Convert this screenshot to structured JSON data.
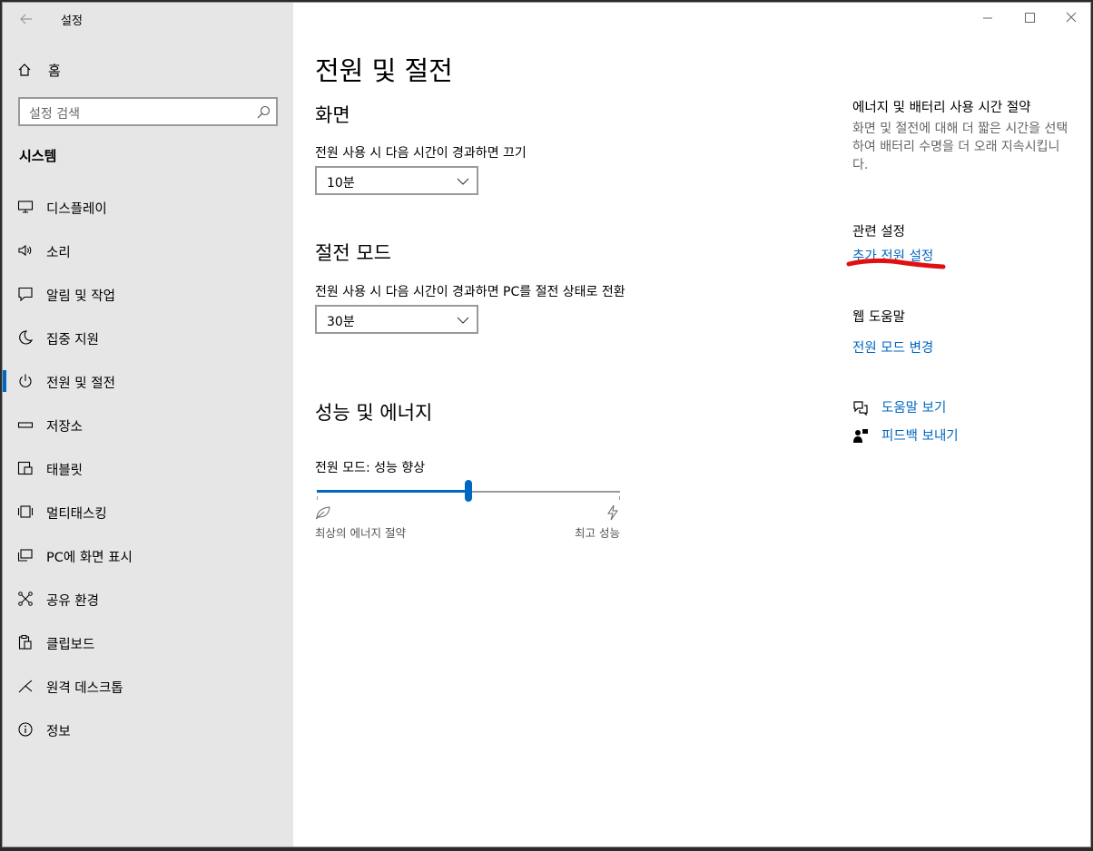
{
  "window": {
    "app_title": "설정"
  },
  "sidebar": {
    "home_label": "홈",
    "search_placeholder": "설정 검색",
    "section_title": "시스템",
    "items": [
      {
        "label": "디스플레이",
        "icon": "monitor-icon"
      },
      {
        "label": "소리",
        "icon": "speaker-icon"
      },
      {
        "label": "알림 및 작업",
        "icon": "notification-icon"
      },
      {
        "label": "집중 지원",
        "icon": "moon-icon"
      },
      {
        "label": "전원 및 절전",
        "icon": "power-icon",
        "active": true
      },
      {
        "label": "저장소",
        "icon": "storage-icon"
      },
      {
        "label": "태블릿",
        "icon": "tablet-icon"
      },
      {
        "label": "멀티태스킹",
        "icon": "multitasking-icon"
      },
      {
        "label": "PC에 화면 표시",
        "icon": "project-icon"
      },
      {
        "label": "공유 환경",
        "icon": "share-icon"
      },
      {
        "label": "클립보드",
        "icon": "clipboard-icon"
      },
      {
        "label": "원격 데스크톱",
        "icon": "remote-icon"
      },
      {
        "label": "정보",
        "icon": "info-icon"
      }
    ]
  },
  "main": {
    "title": "전원 및 절전",
    "screen": {
      "heading": "화면",
      "label": "전원 사용 시 다음 시간이 경과하면 끄기",
      "value": "10분"
    },
    "sleep": {
      "heading": "절전 모드",
      "label": "전원 사용 시 다음 시간이 경과하면 PC를 절전 상태로 전환",
      "value": "30분"
    },
    "performance": {
      "heading": "성능 및 에너지",
      "mode_label": "전원 모드: 성능 향상",
      "slider_fraction": 0.5,
      "min_label": "최상의 에너지 절약",
      "max_label": "최고 성능"
    }
  },
  "right": {
    "save": {
      "heading": "에너지 및 배터리 사용 시간 절약",
      "desc": "화면 및 절전에 대해 더 짧은 시간을 선택하여 배터리 수명을 더 오래 지속시킵니다."
    },
    "related": {
      "heading": "관련 설정",
      "link": "추가 전원 설정"
    },
    "web_help": {
      "heading": "웹 도움말",
      "link": "전원 모드 변경"
    },
    "help_link": "도움말 보기",
    "feedback_link": "피드백 보내기"
  },
  "colors": {
    "accent": "#0067c0",
    "sidebar_bg": "#e6e6e6",
    "annotation_red": "#e01010"
  }
}
